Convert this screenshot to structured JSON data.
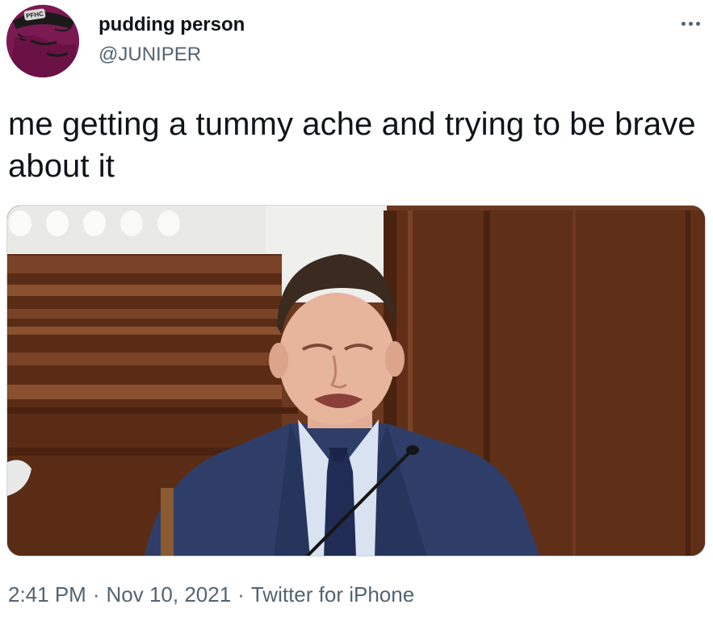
{
  "author": {
    "display_name": "pudding person",
    "handle": "@JUNIPER",
    "avatar_icon": "avatar-cartoon-icon",
    "avatar_badge_text": "PFHC"
  },
  "tweet": {
    "text": "me getting a tummy ache and trying to be brave about it",
    "media_icon": "photo-icon"
  },
  "meta": {
    "time": "2:41 PM",
    "date": "Nov 10, 2021",
    "source": "Twitter for iPhone",
    "separator": "·"
  },
  "more_icon": "more-options-icon",
  "colors": {
    "text": "#0f1419",
    "secondary": "#536471",
    "border": "#cfd9de",
    "avatar_bg": "#7a1a52"
  }
}
